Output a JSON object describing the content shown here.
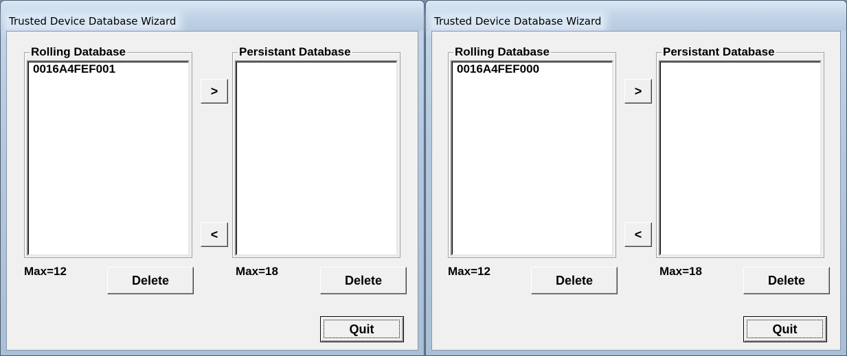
{
  "windows": [
    {
      "title": "Trusted Device Database Wizard",
      "rolling": {
        "legend": "Rolling Database",
        "items": [
          "0016A4FEF001"
        ],
        "max": "Max=12",
        "delete_label": "Delete"
      },
      "persistant": {
        "legend": "Persistant Database",
        "items": [],
        "max": "Max=18",
        "delete_label": "Delete"
      },
      "move_right_label": ">",
      "move_left_label": "<",
      "quit_label": "Quit"
    },
    {
      "title": "Trusted Device Database Wizard",
      "rolling": {
        "legend": "Rolling Database",
        "items": [
          "0016A4FEF000"
        ],
        "max": "Max=12",
        "delete_label": "Delete"
      },
      "persistant": {
        "legend": "Persistant Database",
        "items": [],
        "max": "Max=18",
        "delete_label": "Delete"
      },
      "move_right_label": ">",
      "move_left_label": "<",
      "quit_label": "Quit"
    }
  ]
}
